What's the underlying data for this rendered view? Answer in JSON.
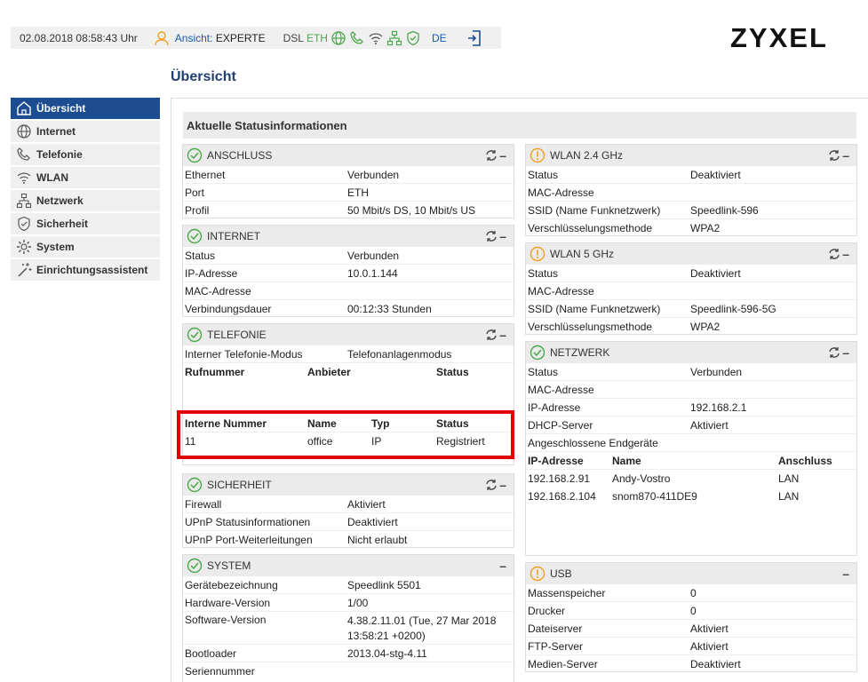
{
  "topbar": {
    "datetime": "02.08.2018 08:58:43 Uhr",
    "view_label": "Ansicht:",
    "view_value": "EXPERTE",
    "dsl": "DSL",
    "eth": "ETH",
    "lang": "DE",
    "logo": "ZYXEL"
  },
  "page_title": "Übersicht",
  "sidebar": {
    "items": [
      {
        "label": "Übersicht"
      },
      {
        "label": "Internet"
      },
      {
        "label": "Telefonie"
      },
      {
        "label": "WLAN"
      },
      {
        "label": "Netzwerk"
      },
      {
        "label": "Sicherheit"
      },
      {
        "label": "System"
      },
      {
        "label": "Einrichtungsassistent"
      }
    ]
  },
  "main_head": "Aktuelle Statusinformationen",
  "anschluss": {
    "title": "ANSCHLUSS",
    "rows": [
      {
        "k": "Ethernet",
        "v": "Verbunden"
      },
      {
        "k": "Port",
        "v": "ETH"
      },
      {
        "k": "Profil",
        "v": "50 Mbit/s DS, 10 Mbit/s US"
      }
    ]
  },
  "internet": {
    "title": "INTERNET",
    "rows": [
      {
        "k": "Status",
        "v": "Verbunden"
      },
      {
        "k": "IP-Adresse",
        "v": "10.0.1.144"
      },
      {
        "k": "MAC-Adresse",
        "v": ""
      },
      {
        "k": "Verbindungsdauer",
        "v": "00:12:33 Stunden"
      }
    ]
  },
  "telefonie": {
    "title": "TELEFONIE",
    "mode_k": "Interner Telefonie-Modus",
    "mode_v": "Telefonanlagenmodus",
    "head1": [
      "Rufnummer",
      "Anbieter",
      "Status"
    ],
    "head2": [
      "Interne Nummer",
      "Name",
      "Typ",
      "Status"
    ],
    "int_row": [
      "11",
      "office",
      "IP",
      "Registriert"
    ]
  },
  "sicherheit": {
    "title": "SICHERHEIT",
    "rows": [
      {
        "k": "Firewall",
        "v": "Aktiviert"
      },
      {
        "k": "UPnP Statusinformationen",
        "v": "Deaktiviert"
      },
      {
        "k": "UPnP Port-Weiterleitungen",
        "v": "Nicht erlaubt"
      }
    ]
  },
  "system": {
    "title": "SYSTEM",
    "rows": [
      {
        "k": "Gerätebezeichnung",
        "v": "Speedlink 5501"
      },
      {
        "k": "Hardware-Version",
        "v": "1/00"
      },
      {
        "k": "Software-Version",
        "v": "4.38.2.11.01 (Tue, 27 Mar 2018 13:58:21 +0200)"
      },
      {
        "k": "Bootloader",
        "v": "2013.04-stg-4.11"
      },
      {
        "k": "Seriennummer",
        "v": ""
      }
    ]
  },
  "wlan24": {
    "title": "WLAN 2.4 GHz",
    "rows": [
      {
        "k": "Status",
        "v": "Deaktiviert"
      },
      {
        "k": "MAC-Adresse",
        "v": ""
      },
      {
        "k": "SSID (Name Funknetzwerk)",
        "v": "Speedlink-596"
      },
      {
        "k": "Verschlüsselungsmethode",
        "v": "WPA2"
      }
    ]
  },
  "wlan5": {
    "title": "WLAN 5 GHz",
    "rows": [
      {
        "k": "Status",
        "v": "Deaktiviert"
      },
      {
        "k": "MAC-Adresse",
        "v": ""
      },
      {
        "k": "SSID (Name Funknetzwerk)",
        "v": "Speedlink-596-5G"
      },
      {
        "k": "Verschlüsselungsmethode",
        "v": "WPA2"
      }
    ]
  },
  "netzwerk": {
    "title": "NETZWERK",
    "rows": [
      {
        "k": "Status",
        "v": "Verbunden"
      },
      {
        "k": "MAC-Adresse",
        "v": ""
      },
      {
        "k": "IP-Adresse",
        "v": "192.168.2.1"
      },
      {
        "k": "DHCP-Server",
        "v": "Aktiviert"
      },
      {
        "k": "Angeschlossene Endgeräte",
        "v": ""
      }
    ],
    "dev_head": [
      "IP-Adresse",
      "Name",
      "Anschluss"
    ],
    "devices": [
      [
        "192.168.2.91",
        "Andy-Vostro",
        "LAN"
      ],
      [
        "192.168.2.104",
        "snom870-411DE9",
        "LAN"
      ]
    ]
  },
  "usb": {
    "title": "USB",
    "rows": [
      {
        "k": "Massenspeicher",
        "v": "0"
      },
      {
        "k": "Drucker",
        "v": "0"
      },
      {
        "k": "Dateiserver",
        "v": "Aktiviert"
      },
      {
        "k": "FTP-Server",
        "v": "Aktiviert"
      },
      {
        "k": "Medien-Server",
        "v": "Deaktiviert"
      }
    ]
  },
  "colors": {
    "accent": "#1e4c91",
    "ok": "#4aa84a",
    "warn": "#f0a020",
    "highlight": "#e00000"
  }
}
